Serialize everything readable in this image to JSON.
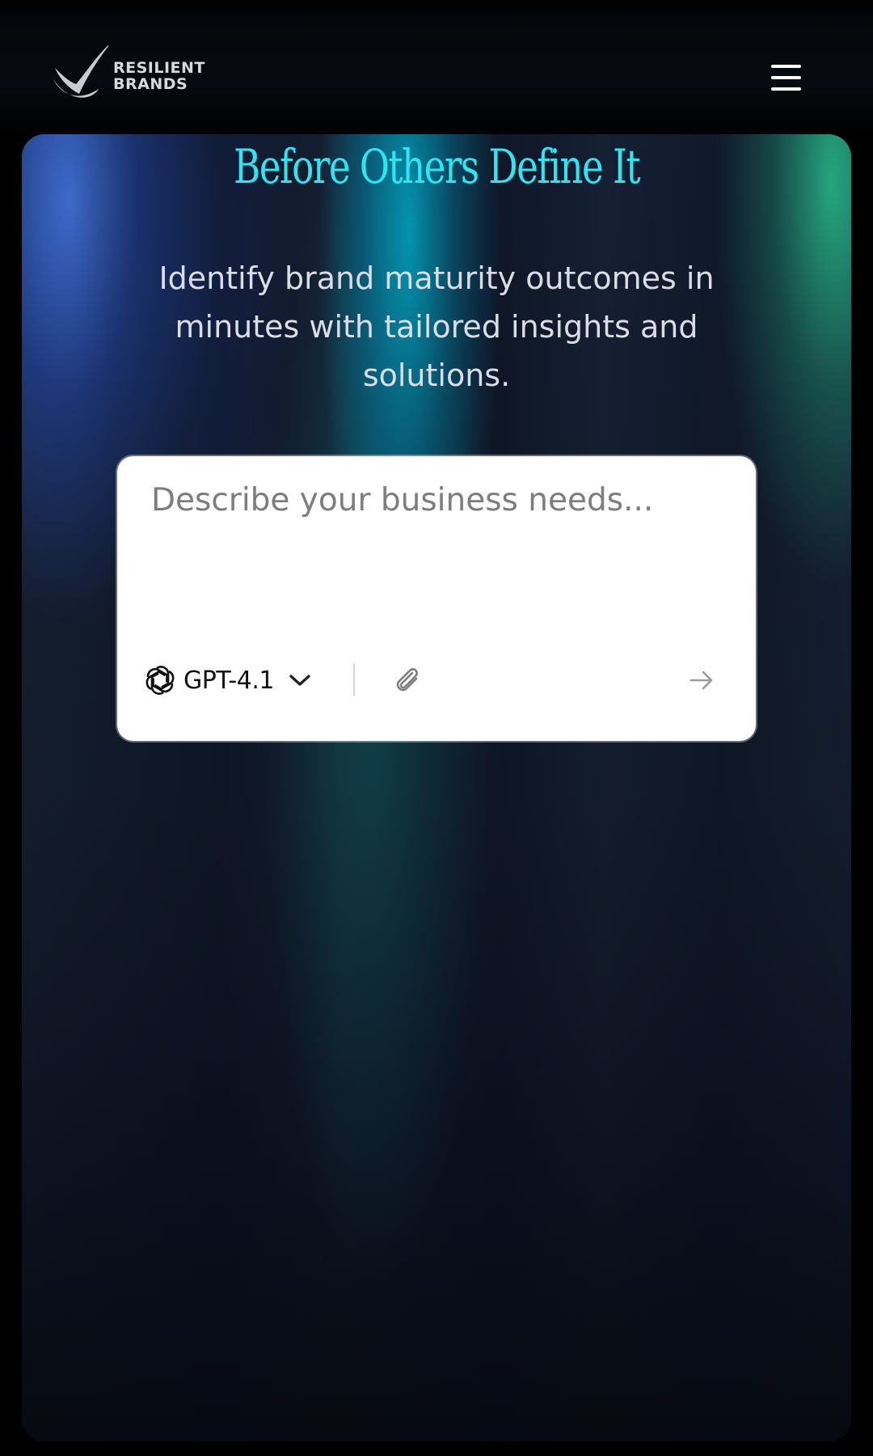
{
  "header": {
    "brand_line1": "RESILIENT",
    "brand_line2": "BRANDS",
    "logo_icon": "checkmark-swoosh-icon",
    "menu_icon": "hamburger-menu-icon"
  },
  "hero": {
    "headline": "Before Others Define It",
    "subtext": "Identify brand maturity outcomes in minutes with tailored insights and solutions."
  },
  "prompt": {
    "placeholder": "Describe your business needs...",
    "value": "",
    "model_label": "GPT-4.1",
    "model_icon": "openai-logo-icon",
    "dropdown_icon": "chevron-down-icon",
    "attach_icon": "paperclip-icon",
    "send_icon": "arrow-right-icon"
  },
  "colors": {
    "headline": "#2ee6f2",
    "subtext": "#d9dde4",
    "card_bg": "#ffffff",
    "page_bg": "#000000"
  }
}
